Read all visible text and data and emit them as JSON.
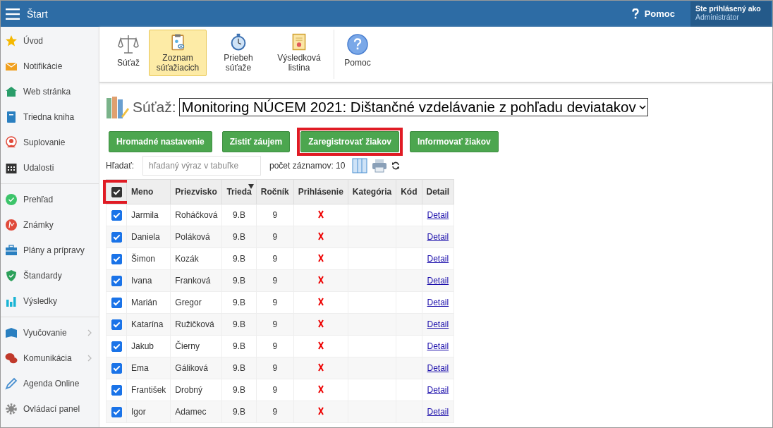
{
  "topbar": {
    "title": "Štart",
    "help": "Pomoc",
    "user_label": "Ste prihlásený ako",
    "user_name": "Administrátor"
  },
  "sidebar": {
    "groups": [
      [
        {
          "label": "Úvod",
          "submenu": false
        },
        {
          "label": "Notifikácie",
          "submenu": false
        },
        {
          "label": "Web stránka",
          "submenu": false
        },
        {
          "label": "Triedna kniha",
          "submenu": false
        },
        {
          "label": "Suplovanie",
          "submenu": false
        },
        {
          "label": "Udalosti",
          "submenu": false
        }
      ],
      [
        {
          "label": "Prehľad",
          "submenu": false
        },
        {
          "label": "Známky",
          "submenu": false
        },
        {
          "label": "Plány a prípravy",
          "submenu": false
        },
        {
          "label": "Štandardy",
          "submenu": false
        },
        {
          "label": "Výsledky",
          "submenu": false
        }
      ],
      [
        {
          "label": "Vyučovanie",
          "submenu": true
        },
        {
          "label": "Komunikácia",
          "submenu": true
        },
        {
          "label": "Agenda Online",
          "submenu": false
        },
        {
          "label": "Ovládací panel",
          "submenu": false
        }
      ]
    ]
  },
  "toolbar": {
    "groups": [
      [
        {
          "label": "Súťaž",
          "selected": false
        },
        {
          "label": "Zoznam súťažiacich",
          "selected": true
        },
        {
          "label": "Priebeh súťaže",
          "selected": false
        },
        {
          "label": "Výsledková listina",
          "selected": false
        }
      ],
      [
        {
          "label": "Pomoc",
          "selected": false
        }
      ]
    ]
  },
  "competition": {
    "label": "Súťaž:",
    "value": "Monitoring NÚCEM 2021: Dištančné vzdelávanie z pohľadu deviatakov"
  },
  "actions": [
    {
      "label": "Hromadné nastavenie",
      "highlighted": false
    },
    {
      "label": "Zistiť záujem",
      "highlighted": false
    },
    {
      "label": "Zaregistrovať žiakov",
      "highlighted": true
    },
    {
      "label": "Informovať žiakov",
      "highlighted": false
    }
  ],
  "search": {
    "label": "Hľadať:",
    "placeholder": "hľadaný výraz v tabuľke",
    "count": "počet záznamov: 10"
  },
  "table": {
    "select_all": {
      "checked": true,
      "highlighted": true
    },
    "columns": [
      {
        "label": "Meno",
        "sorted": false
      },
      {
        "label": "Priezvisko",
        "sorted": false
      },
      {
        "label": "Trieda",
        "sorted": true
      },
      {
        "label": "Ročník",
        "sorted": false
      },
      {
        "label": "Prihlásenie",
        "sorted": false
      },
      {
        "label": "Kategória",
        "sorted": false
      },
      {
        "label": "Kód",
        "sorted": false
      },
      {
        "label": "Detail",
        "sorted": false
      }
    ],
    "rows": [
      {
        "checked": true,
        "name": "Jarmila",
        "surname": "Roháčková",
        "class": "9.B",
        "year": "9",
        "registered": false,
        "link": "Detail"
      },
      {
        "checked": true,
        "name": "Daniela",
        "surname": "Poláková",
        "class": "9.B",
        "year": "9",
        "registered": false,
        "link": "Detail"
      },
      {
        "checked": true,
        "name": "Šimon",
        "surname": "Kozák",
        "class": "9.B",
        "year": "9",
        "registered": false,
        "link": "Detail"
      },
      {
        "checked": true,
        "name": "Ivana",
        "surname": "Franková",
        "class": "9.B",
        "year": "9",
        "registered": false,
        "link": "Detail"
      },
      {
        "checked": true,
        "name": "Marián",
        "surname": "Gregor",
        "class": "9.B",
        "year": "9",
        "registered": false,
        "link": "Detail"
      },
      {
        "checked": true,
        "name": "Katarína",
        "surname": "Ružičková",
        "class": "9.B",
        "year": "9",
        "registered": false,
        "link": "Detail"
      },
      {
        "checked": true,
        "name": "Jakub",
        "surname": "Čierny",
        "class": "9.B",
        "year": "9",
        "registered": false,
        "link": "Detail"
      },
      {
        "checked": true,
        "name": "Ema",
        "surname": "Gáliková",
        "class": "9.B",
        "year": "9",
        "registered": false,
        "link": "Detail"
      },
      {
        "checked": true,
        "name": "František",
        "surname": "Drobný",
        "class": "9.B",
        "year": "9",
        "registered": false,
        "link": "Detail"
      },
      {
        "checked": true,
        "name": "Igor",
        "surname": "Adamec",
        "class": "9.B",
        "year": "9",
        "registered": false,
        "link": "Detail"
      }
    ]
  }
}
